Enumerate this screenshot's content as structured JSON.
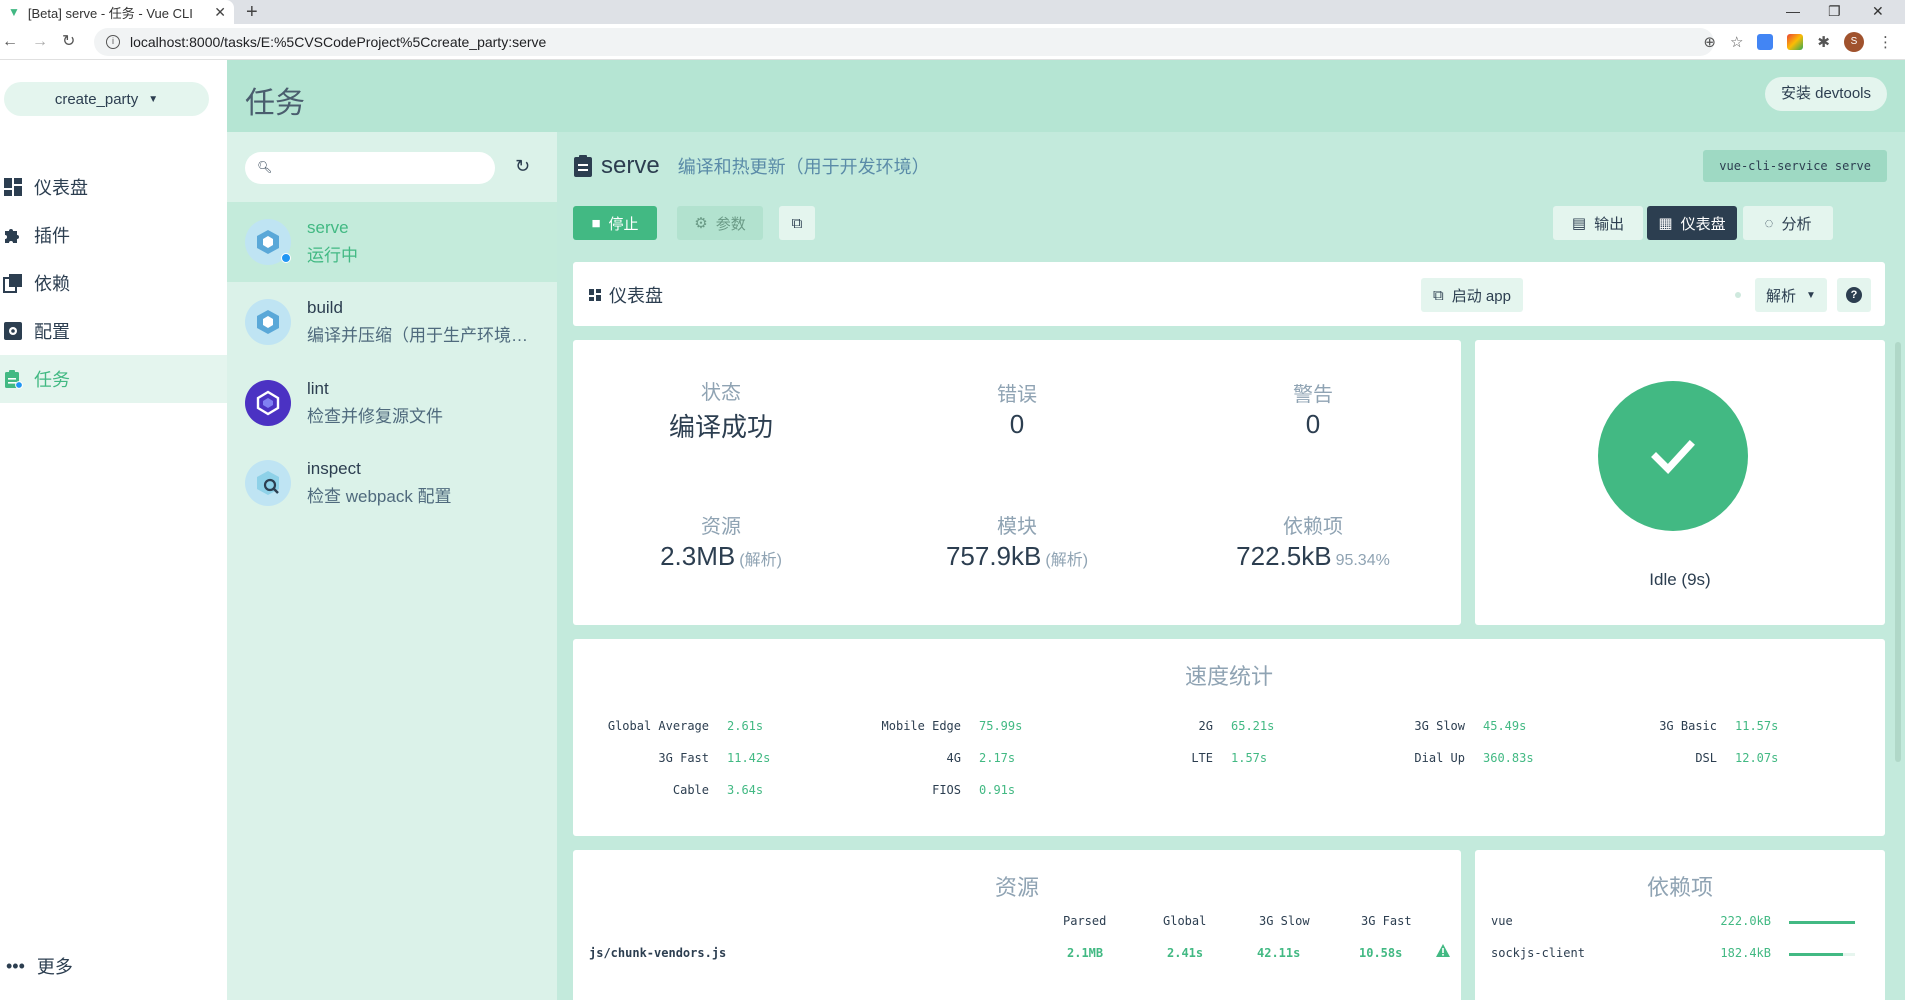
{
  "browser": {
    "tab_title": "[Beta] serve - 任务 - Vue CLI",
    "url": "localhost:8000/tasks/E:%5CVSCodeProject%5Ccreate_party:serve"
  },
  "sidebar": {
    "project": "create_party",
    "items": [
      {
        "label": "仪表盘",
        "icon": "dashboard-icon"
      },
      {
        "label": "插件",
        "icon": "puzzle-icon"
      },
      {
        "label": "依赖",
        "icon": "library-icon"
      },
      {
        "label": "配置",
        "icon": "settings-icon"
      },
      {
        "label": "任务",
        "icon": "clipboard-icon",
        "active": true
      }
    ],
    "more_label": "更多"
  },
  "topbar": {
    "title": "任务",
    "devtools_label": "安装 devtools"
  },
  "task_list": {
    "search_placeholder": "",
    "tasks": [
      {
        "name": "serve",
        "desc": "运行中",
        "active": true
      },
      {
        "name": "build",
        "desc": "编译并压缩（用于生产环境…"
      },
      {
        "name": "lint",
        "desc": "检查并修复源文件"
      },
      {
        "name": "inspect",
        "desc": "检查 webpack 配置"
      }
    ]
  },
  "task": {
    "name": "serve",
    "description": "编译和热更新（用于开发环境）",
    "command": "vue-cli-service serve",
    "stop_label": "停止",
    "params_label": "参数",
    "views": {
      "output": "输出",
      "dashboard": "仪表盘",
      "analyze": "分析"
    }
  },
  "dashboard": {
    "title": "仪表盘",
    "start_app_label": "启动 app",
    "parse_label": "解析",
    "stats": {
      "status": {
        "label": "状态",
        "value": "编译成功"
      },
      "errors": {
        "label": "错误",
        "value": "0"
      },
      "warnings": {
        "label": "警告",
        "value": "0"
      },
      "assets": {
        "label": "资源",
        "value": "2.3MB",
        "sub": "(解析)"
      },
      "modules": {
        "label": "模块",
        "value": "757.9kB",
        "sub": "(解析)"
      },
      "deps": {
        "label": "依赖项",
        "value": "722.5kB",
        "sub": "95.34%"
      }
    },
    "status_text": "Idle (9s)",
    "speed": {
      "title": "速度统计",
      "items": [
        {
          "name": "Global Average",
          "value": "2.61s"
        },
        {
          "name": "Mobile Edge",
          "value": "75.99s"
        },
        {
          "name": "2G",
          "value": "65.21s"
        },
        {
          "name": "3G Slow",
          "value": "45.49s"
        },
        {
          "name": "3G Basic",
          "value": "11.57s"
        },
        {
          "name": "3G Fast",
          "value": "11.42s"
        },
        {
          "name": "4G",
          "value": "2.17s"
        },
        {
          "name": "LTE",
          "value": "1.57s"
        },
        {
          "name": "Dial Up",
          "value": "360.83s"
        },
        {
          "name": "DSL",
          "value": "12.07s"
        },
        {
          "name": "Cable",
          "value": "3.64s"
        },
        {
          "name": "FIOS",
          "value": "0.91s"
        }
      ]
    },
    "assets": {
      "title": "资源",
      "headers": [
        "Parsed",
        "Global",
        "3G Slow",
        "3G Fast"
      ],
      "rows": [
        {
          "name": "js/chunk-vendors.js",
          "parsed": "2.1MB",
          "global": "2.41s",
          "slow": "42.11s",
          "fast": "10.58s"
        }
      ]
    },
    "deps": {
      "title": "依赖项",
      "rows": [
        {
          "name": "vue",
          "size": "222.0kB",
          "ratio": 1.0
        },
        {
          "name": "sockjs-client",
          "size": "182.4kB",
          "ratio": 0.82
        }
      ]
    }
  }
}
